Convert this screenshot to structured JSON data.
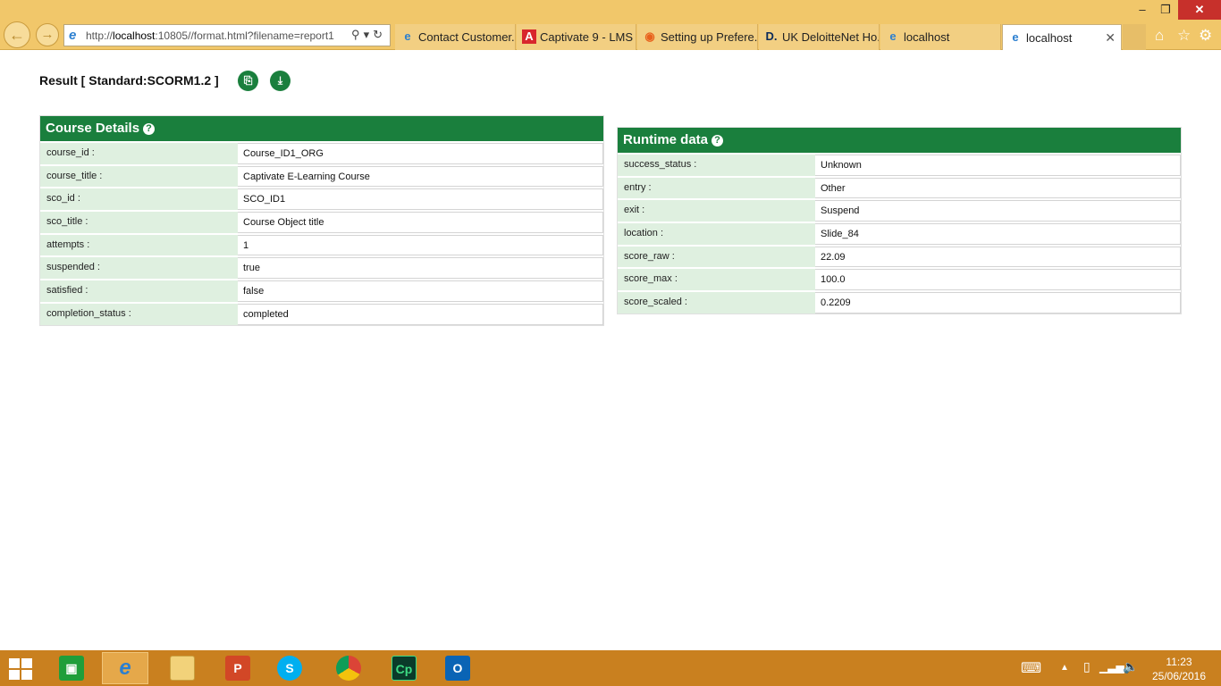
{
  "browser": {
    "address_url_prefix": "http://",
    "address_url_host": "localhost",
    "address_url_rest": ":10805//format.html?filename=report1",
    "window_controls": {
      "minimize": "–",
      "maximize": "❐",
      "close": "✕"
    },
    "tabs": [
      {
        "label": "Contact Customer...",
        "icon": "ie-page-icon"
      },
      {
        "label": "Captivate 9 - LMS ...",
        "icon": "adobe-icon"
      },
      {
        "label": "Setting up Prefere...",
        "icon": "firefox-icon"
      },
      {
        "label": "UK DeloitteNet Ho...",
        "icon": "deloitte-icon"
      },
      {
        "label": "localhost",
        "icon": "ie-page-icon"
      },
      {
        "label": "localhost",
        "icon": "ie-page-icon",
        "active": true
      }
    ]
  },
  "page": {
    "result_title": "Result [ Standard:SCORM1.2 ]"
  },
  "course_details": {
    "title": "Course Details",
    "rows": [
      {
        "key": "course_id :",
        "value": "Course_ID1_ORG"
      },
      {
        "key": "course_title :",
        "value": "Captivate E-Learning Course"
      },
      {
        "key": "sco_id :",
        "value": "SCO_ID1"
      },
      {
        "key": "sco_title :",
        "value": "Course Object title"
      },
      {
        "key": "attempts :",
        "value": "1"
      },
      {
        "key": "suspended :",
        "value": "true"
      },
      {
        "key": "satisfied :",
        "value": "false"
      },
      {
        "key": "completion_status :",
        "value": "completed"
      }
    ]
  },
  "runtime_data": {
    "title": "Runtime data",
    "rows": [
      {
        "key": "success_status :",
        "value": "Unknown"
      },
      {
        "key": "entry :",
        "value": "Other"
      },
      {
        "key": "exit :",
        "value": "Suspend"
      },
      {
        "key": "location :",
        "value": "Slide_84"
      },
      {
        "key": "score_raw :",
        "value": "22.09"
      },
      {
        "key": "score_max :",
        "value": "100.0"
      },
      {
        "key": "score_scaled :",
        "value": "0.2209"
      }
    ]
  },
  "taskbar": {
    "apps": [
      {
        "name": "store",
        "label": ""
      },
      {
        "name": "internet-explorer",
        "label": "e"
      },
      {
        "name": "file-explorer",
        "label": ""
      },
      {
        "name": "powerpoint",
        "label": "P"
      },
      {
        "name": "skype",
        "label": "S"
      },
      {
        "name": "chrome",
        "label": ""
      },
      {
        "name": "captivate",
        "label": "Cp"
      },
      {
        "name": "outlook",
        "label": "O"
      }
    ],
    "time": "11:23",
    "date": "25/06/2016"
  },
  "colors": {
    "accent_green": "#1a7f3d",
    "key_cell_bg": "#dff0e0",
    "chrome_bg": "#f1c76a",
    "taskbar_bg": "#c9801f"
  }
}
